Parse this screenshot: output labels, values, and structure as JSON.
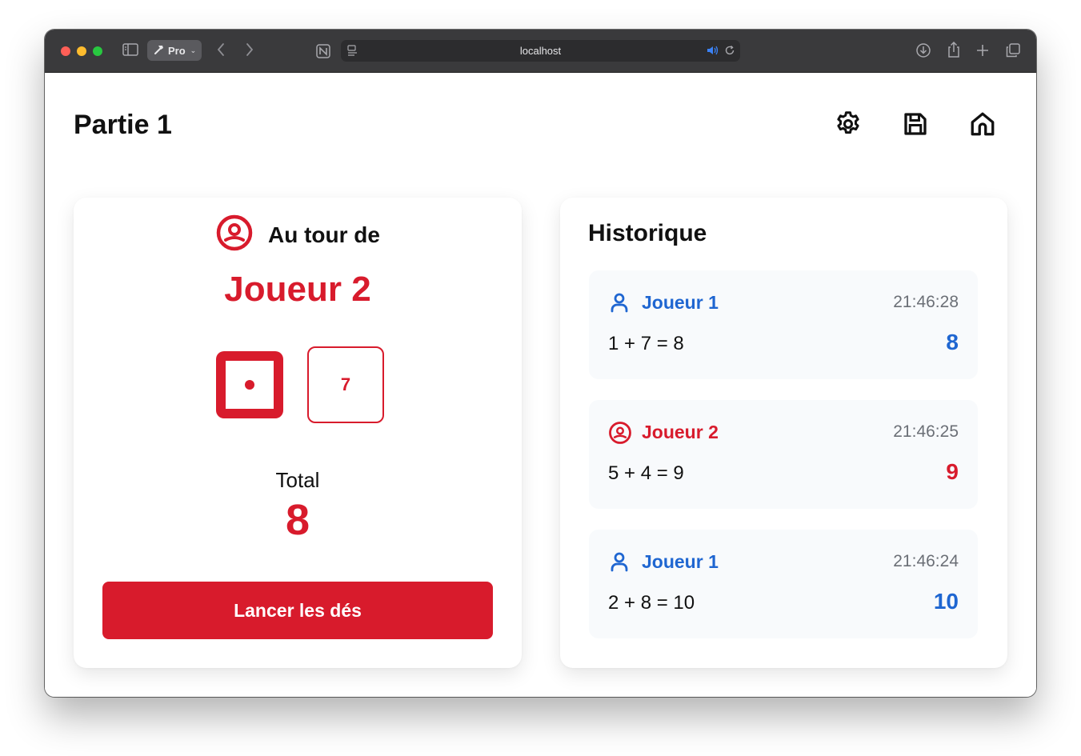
{
  "browser": {
    "profile_label": "Pro",
    "url": "localhost"
  },
  "page": {
    "title": "Partie 1"
  },
  "turn": {
    "label": "Au tour de",
    "player": "Joueur 2",
    "die1_value": 1,
    "die2_value": "7",
    "total_label": "Total",
    "total_value": "8",
    "roll_button": "Lancer les dés"
  },
  "history": {
    "title": "Historique",
    "items": [
      {
        "player": "Joueur 1",
        "time": "21:46:28",
        "equation": "1 + 7 = 8",
        "score": "8",
        "color": "#1f66d1",
        "icon": "user-icon"
      },
      {
        "player": "Joueur 2",
        "time": "21:46:25",
        "equation": "5 + 4 = 9",
        "score": "9",
        "color": "#d81b2c",
        "icon": "user-circle-icon"
      },
      {
        "player": "Joueur 1",
        "time": "21:46:24",
        "equation": "2 + 8 = 10",
        "score": "10",
        "color": "#1f66d1",
        "icon": "user-icon"
      }
    ]
  },
  "colors": {
    "accent_red": "#d81b2c",
    "accent_blue": "#1f66d1"
  }
}
